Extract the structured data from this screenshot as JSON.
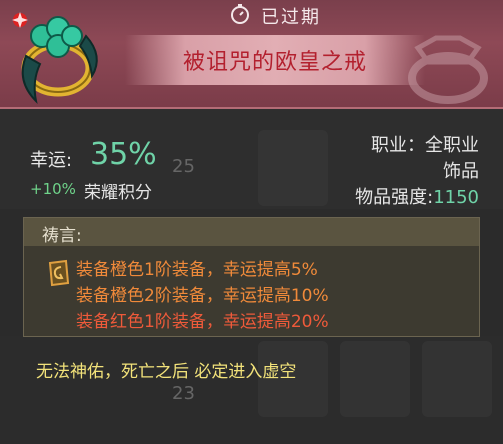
{
  "header": {
    "status_label": "已过期",
    "item_title": "被诅咒的欧皇之戒",
    "status_icon": "timer-icon"
  },
  "stats": {
    "luck_label": "幸运:",
    "luck_value": "35%",
    "bonus_value": "+10%",
    "bonus_label": "荣耀积分",
    "job_line": "职业：全职业",
    "type_line": "饰品",
    "power_label": "物品强度:",
    "power_value": "1150"
  },
  "incantation": {
    "title": "祷言:",
    "lines": [
      "装备橙色1阶装备，幸运提高5%",
      "装备橙色2阶装备，幸运提高10%",
      "装备红色1阶装备，幸运提高20%"
    ]
  },
  "footer": {
    "curse_text": "无法神佑，死亡之后 必定进入虚空"
  },
  "background": {
    "number_1": "25",
    "number_2": "23"
  },
  "colors": {
    "header_bg": "#8e4956",
    "title_red": "#b3202e",
    "luck_green": "#6fd3a8",
    "orange": "#f08a3a",
    "red_orange": "#ef5a3a",
    "footer_yellow": "#f2e27a"
  }
}
